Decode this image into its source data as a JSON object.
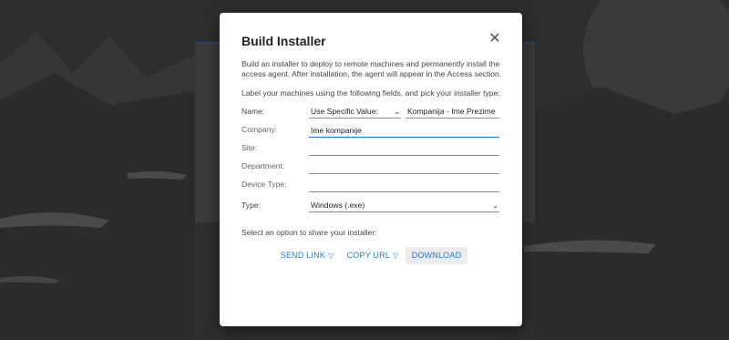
{
  "dialog": {
    "title": "Build Installer",
    "description": "Build an installer to deploy to remote machines and permanently install the access agent. After installation, the agent will appear in the Access section.",
    "prompt": "Label your machines using the following fields, and pick your installer type:",
    "fields": {
      "name": {
        "label": "Name:",
        "mode": "Use Specific Value:",
        "value": "Kompanija - Ime Prezime"
      },
      "company": {
        "label": "Company:",
        "value": "Ime kompanije"
      },
      "site": {
        "label": "Site:",
        "value": ""
      },
      "department": {
        "label": "Department:",
        "value": ""
      },
      "device_type": {
        "label": "Device Type:",
        "value": ""
      },
      "type": {
        "label": "Type:",
        "value": "Windows (.exe)"
      }
    },
    "share_label": "Select an option to share your installer:",
    "buttons": {
      "send_link": "SEND LINK",
      "copy_url": "COPY URL",
      "download": "DOWNLOAD"
    }
  },
  "icons": {
    "close": "close-icon",
    "chevron": "chevron-down-icon",
    "dropdown_triangle": "triangle-down-icon"
  },
  "colors": {
    "accent": "#1e7bd6",
    "overlay_bg": "#2f2f2f"
  }
}
